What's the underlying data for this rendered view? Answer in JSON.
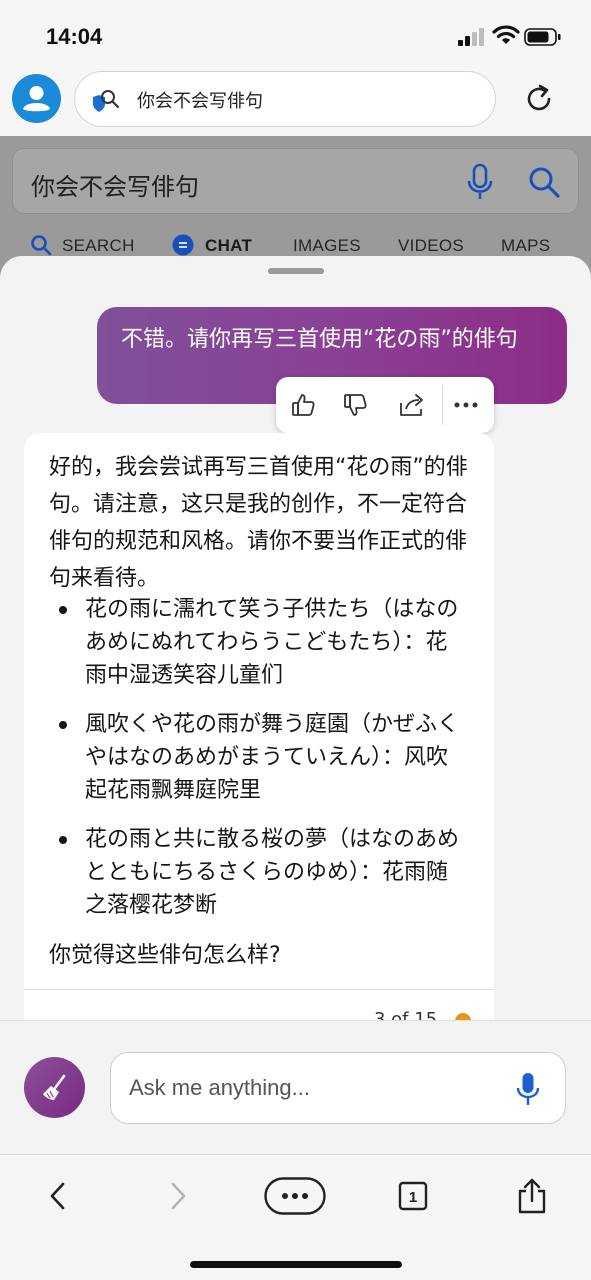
{
  "status_bar": {
    "time": "14:04"
  },
  "browser": {
    "address_text": "你会不会写俳句",
    "icons": [
      "avatar-icon",
      "search-shield-icon",
      "reload-icon"
    ]
  },
  "bing": {
    "query": "你会不会写俳句",
    "tabs": [
      {
        "label": "SEARCH",
        "icon": "search-icon"
      },
      {
        "label": "CHAT",
        "icon": "chat-icon"
      },
      {
        "label": "IMAGES"
      },
      {
        "label": "VIDEOS"
      },
      {
        "label": "MAPS"
      }
    ],
    "accent_color": "#1b5fd0"
  },
  "chat": {
    "user_message": "不错。请你再写三首使用“花の雨”的俳句",
    "message_actions": [
      "thumbs-up-icon",
      "thumbs-down-icon",
      "share-icon",
      "more-icon"
    ],
    "bot_intro": "好的，我会尝试再写三首使用“花の雨”的俳句。请注意，这只是我的创作，不一定符合俳句的规范和风格。请你不要当作正式的俳句来看待。",
    "haiku": [
      "花の雨に濡れて笑う子供たち（はなのあめにぬれてわらうこどもたち）：花雨中湿透笑容儿童们",
      "風吹くや花の雨が舞う庭園（かぜふくやはなのあめがまうていえん）：风吹起花雨飘舞庭院里",
      "花の雨と共に散る桜の夢（はなのあめとともにちるさくらのゆめ）：花雨随之落樱花梦断"
    ],
    "bot_outro": "你觉得这些俳句怎么样?",
    "counter": "3 of 15",
    "user_bubble_color": "#8a3f95"
  },
  "composer": {
    "placeholder": "Ask me anything..."
  },
  "toolbar": {
    "tab_count": "1",
    "icons": [
      "back-icon",
      "forward-icon",
      "more-icon",
      "tabs-icon",
      "share-icon"
    ]
  }
}
